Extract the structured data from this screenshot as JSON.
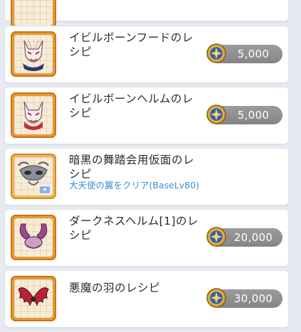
{
  "colors": {
    "background": "#e7eaf1",
    "card": "#ffffff",
    "thumb_frame": "#e89b33",
    "condition_text": "#3a8fd6",
    "price_pill": "#8d8d8d"
  },
  "recipes": [
    {
      "name": "イビルボーンフードのレシピ",
      "price": "5,000",
      "icon": "fox-mask-hood-icon",
      "locked": false,
      "condition": ""
    },
    {
      "name": "イビルボーンヘルムのレシピ",
      "price": "5,000",
      "icon": "fox-mask-helm-icon",
      "locked": false,
      "condition": ""
    },
    {
      "name": "暗黒の舞踏会用仮面のレシピ",
      "price": "",
      "icon": "masquerade-mask-icon",
      "locked": true,
      "condition": "大天使の翼をクリア(BaseLv80)"
    },
    {
      "name": "ダークネスヘルム[1]のレシピ",
      "price": "20,000",
      "icon": "winged-helm-icon",
      "locked": false,
      "condition": ""
    },
    {
      "name": "悪魔の羽のレシピ",
      "price": "30,000",
      "icon": "devil-wings-icon",
      "locked": false,
      "condition": ""
    }
  ]
}
